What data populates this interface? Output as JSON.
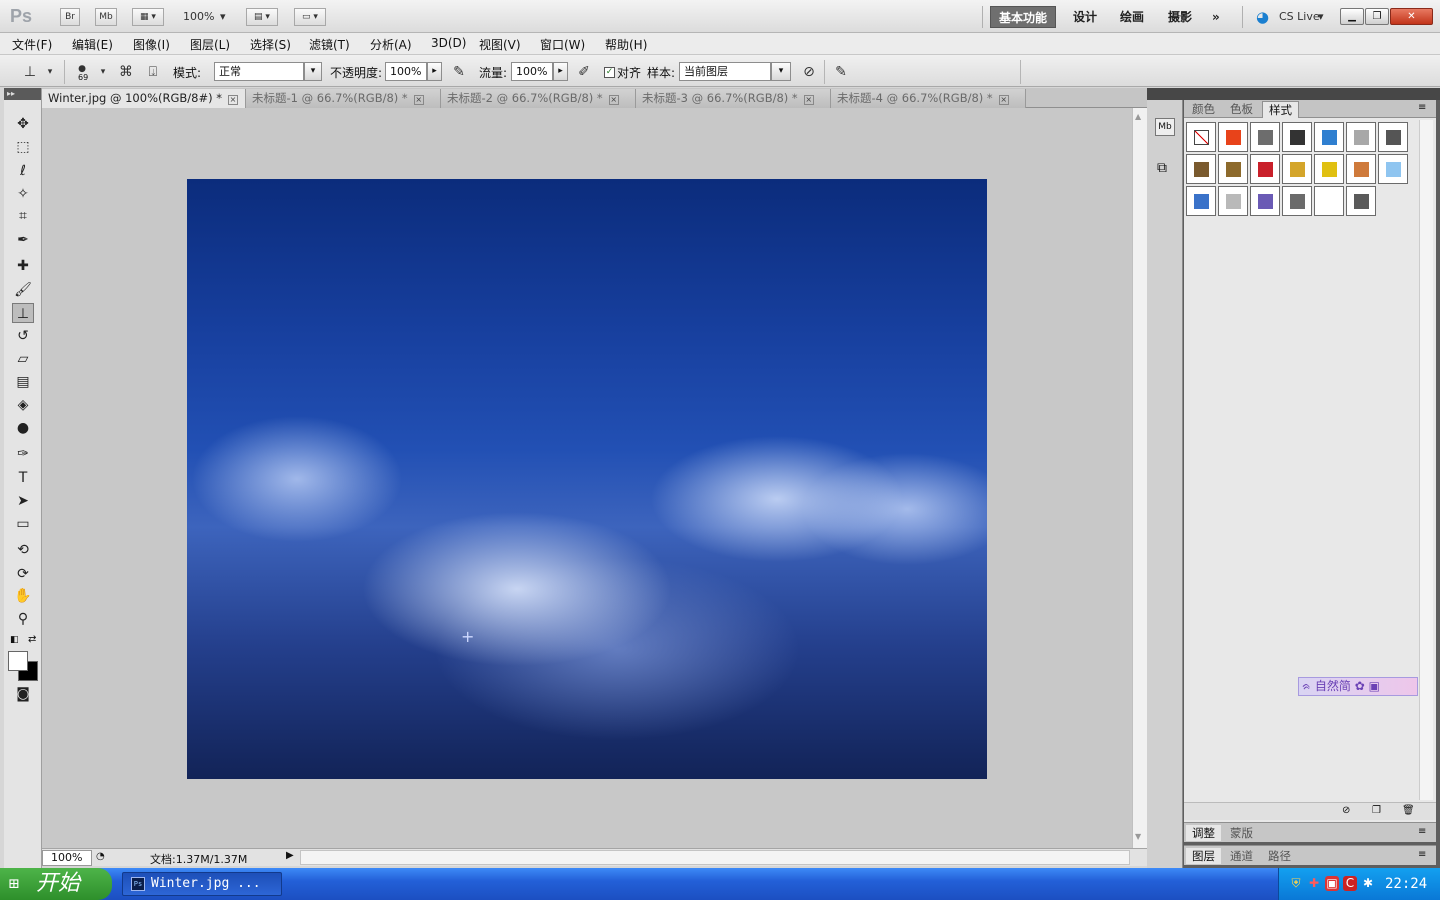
{
  "appbar": {
    "logo": "Ps",
    "br": "Br",
    "mb": "Mb",
    "zoom": "100%",
    "workspaces": [
      "基本功能",
      "设计",
      "绘画",
      "摄影"
    ],
    "cslive": "CS Live"
  },
  "menus": [
    "文件(F)",
    "编辑(E)",
    "图像(I)",
    "图层(L)",
    "选择(S)",
    "滤镜(T)",
    "分析(A)",
    "3D(D)",
    "视图(V)",
    "窗口(W)",
    "帮助(H)"
  ],
  "options": {
    "brush_size": "69",
    "mode_label": "模式:",
    "mode_value": "正常",
    "opacity_label": "不透明度:",
    "opacity_value": "100%",
    "flow_label": "流量:",
    "flow_value": "100%",
    "align_label": "对齐",
    "sample_label": "样本:",
    "sample_value": "当前图层"
  },
  "tabs": [
    {
      "label": "Winter.jpg @ 100%(RGB/8#) *",
      "active": true
    },
    {
      "label": "未标题-1 @ 66.7%(RGB/8) *",
      "active": false
    },
    {
      "label": "未标题-2 @ 66.7%(RGB/8) *",
      "active": false
    },
    {
      "label": "未标题-3 @ 66.7%(RGB/8) *",
      "active": false
    },
    {
      "label": "未标题-4 @ 66.7%(RGB/8) *",
      "active": false
    }
  ],
  "status": {
    "zoom": "100%",
    "doc": "文档:1.37M/1.37M"
  },
  "styles_panel": {
    "tabs": [
      "颜色",
      "色板",
      "样式"
    ],
    "active_tab": "样式",
    "swatches": [
      [
        "none",
        "#e8431a",
        "#6d6d6d",
        "#333333",
        "#2f7fd0",
        "#a8a8a8",
        "#555555"
      ],
      [
        "#7a5a2e",
        "#8d6a2c",
        "#c9202a",
        "#d4a52a",
        "#e0c011",
        "#cf7a3b",
        "#8fc5f0"
      ],
      [
        "#3a72c9",
        "#b9b9b9",
        "#6a5ab5",
        "#6b6b6b",
        "#ffffff",
        "#5a5a5a"
      ]
    ]
  },
  "adjust_group": [
    "调整",
    "蒙版"
  ],
  "layers_group": [
    "图层",
    "通道",
    "路径"
  ],
  "watermark": "自然简",
  "taskbar": {
    "start": "开始",
    "task": "Winter.jpg ...",
    "clock": "22:24"
  }
}
